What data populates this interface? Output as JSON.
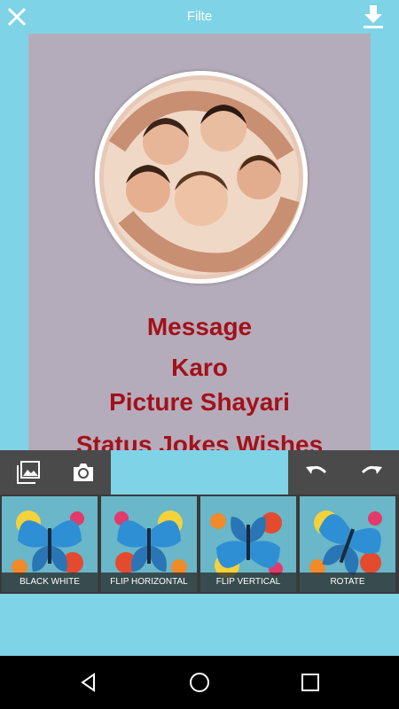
{
  "topbar": {
    "title": "Filte",
    "close_icon": "close-icon",
    "download_icon": "download-icon"
  },
  "card": {
    "background": "#b5acbb",
    "message_lines": [
      "Message",
      "Karo",
      "Picture Shayari",
      "Status Jokes Wishes"
    ],
    "text_color": "#a3111a"
  },
  "tools": {
    "left": [
      "gallery-icon",
      "camera-icon"
    ],
    "right": [
      "undo-icon",
      "redo-icon"
    ]
  },
  "filters": [
    {
      "label": "BLACK WHITE"
    },
    {
      "label": "FLIP HORIZONTAL"
    },
    {
      "label": "FLIP VERTICAL"
    },
    {
      "label": "ROTATE"
    }
  ],
  "navbar": {
    "items": [
      "back-icon",
      "home-icon",
      "recents-icon"
    ]
  },
  "colors": {
    "background": "#7fd3e6",
    "toolbar": "#4a4a4a",
    "filter_strip": "#3a3a3a"
  }
}
